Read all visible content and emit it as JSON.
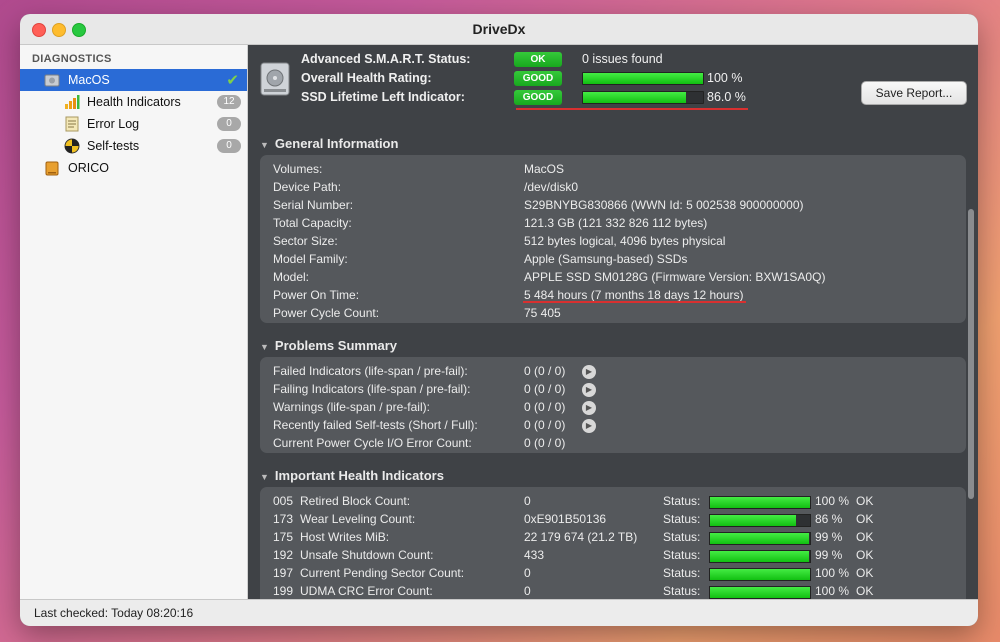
{
  "app": {
    "title": "DriveDx"
  },
  "sidebar": {
    "section_label": "DIAGNOSTICS",
    "items": [
      {
        "label": "MacOS"
      },
      {
        "label": "Health Indicators",
        "badge": "12"
      },
      {
        "label": "Error Log",
        "badge": "0"
      },
      {
        "label": "Self-tests",
        "badge": "0"
      },
      {
        "label": "ORICO"
      }
    ]
  },
  "header": {
    "smart_label": "Advanced S.M.A.R.T. Status:",
    "smart_badge": "OK",
    "smart_text": "0 issues found",
    "health_label": "Overall Health Rating:",
    "health_badge": "GOOD",
    "health_percent": "100 %",
    "health_value": 1.0,
    "ssd_label": "SSD Lifetime Left Indicator:",
    "ssd_badge": "GOOD",
    "ssd_percent": "86.0 %",
    "ssd_value": 0.86,
    "save_button": "Save Report..."
  },
  "general": {
    "title": "General Information",
    "rows": [
      {
        "label": "Volumes:",
        "value": "MacOS"
      },
      {
        "label": "Device Path:",
        "value": "/dev/disk0"
      },
      {
        "label": "Serial Number:",
        "value": "S29BNYBG830866 (WWN Id: 5 002538 900000000)"
      },
      {
        "label": "Total Capacity:",
        "value": "121.3 GB (121 332 826 112 bytes)"
      },
      {
        "label": "Sector Size:",
        "value": "512 bytes logical, 4096 bytes physical"
      },
      {
        "label": "Model Family:",
        "value": "Apple (Samsung-based) SSDs"
      },
      {
        "label": "Model:",
        "value": "APPLE SSD SM0128G  (Firmware Version: BXW1SA0Q)"
      },
      {
        "label": "Power On Time:",
        "value": "5 484 hours (7 months 18 days 12 hours)"
      },
      {
        "label": "Power Cycle Count:",
        "value": "75 405"
      }
    ]
  },
  "problems": {
    "title": "Problems Summary",
    "rows": [
      {
        "label": "Failed Indicators (life-span / pre-fail):",
        "value": "0 (0 / 0)"
      },
      {
        "label": "Failing Indicators (life-span / pre-fail):",
        "value": "0 (0 / 0)"
      },
      {
        "label": "Warnings (life-span / pre-fail):",
        "value": "0 (0 / 0)"
      },
      {
        "label": "Recently failed Self-tests (Short / Full):",
        "value": "0 (0 / 0)"
      },
      {
        "label": "Current Power Cycle I/O Error Count:",
        "value": "0 (0 / 0)"
      }
    ]
  },
  "indicators": {
    "title": "Important Health Indicators",
    "status_label": "Status:",
    "rows": [
      {
        "id": "005",
        "name": "Retired Block Count:",
        "raw": "0",
        "percent": "100 %",
        "value": 1.0,
        "state": "OK"
      },
      {
        "id": "173",
        "name": "Wear Leveling Count:",
        "raw": "0xE901B50136",
        "percent": "86 %",
        "value": 0.86,
        "state": "OK"
      },
      {
        "id": "175",
        "name": "Host Writes MiB:",
        "raw": "22 179 674 (21.2 TB)",
        "percent": "99 %",
        "value": 0.99,
        "state": "OK"
      },
      {
        "id": "192",
        "name": "Unsafe Shutdown Count:",
        "raw": "433",
        "percent": "99 %",
        "value": 0.99,
        "state": "OK"
      },
      {
        "id": "197",
        "name": "Current Pending Sector Count:",
        "raw": "0",
        "percent": "100 %",
        "value": 1.0,
        "state": "OK"
      },
      {
        "id": "199",
        "name": "UDMA CRC Error Count:",
        "raw": "0",
        "percent": "100 %",
        "value": 1.0,
        "state": "OK"
      }
    ]
  },
  "statusbar": {
    "text": "Last checked: Today 08:20:16"
  }
}
